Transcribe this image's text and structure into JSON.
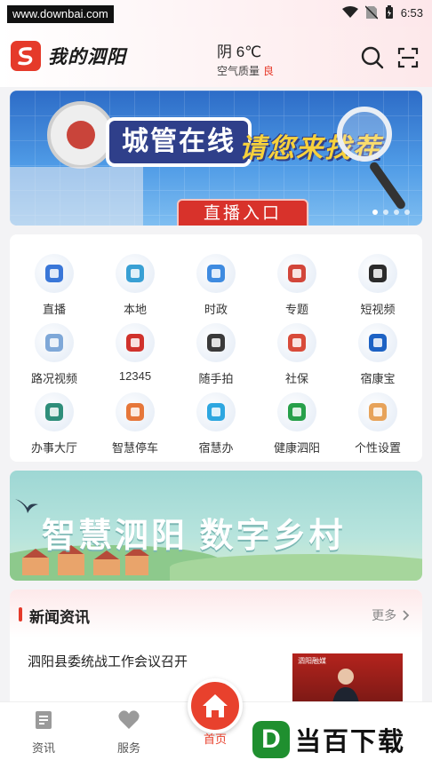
{
  "status_bar": {
    "watermark_url": "www.downbai.com",
    "time": "6:53"
  },
  "header": {
    "app_name": "我的泗阳",
    "weather_temp": "阴 6℃",
    "air_quality_label": "空气质量",
    "air_quality_value": "良"
  },
  "banner": {
    "title": "城管在线",
    "subtitle": "请您来找茬",
    "button_label": "直播入口"
  },
  "grid": [
    {
      "label": "直播",
      "icon": "live-icon",
      "color": "#3a77d8"
    },
    {
      "label": "本地",
      "icon": "local-icon",
      "color": "#39a0d4"
    },
    {
      "label": "时政",
      "icon": "politics-icon",
      "color": "#3f8be0"
    },
    {
      "label": "专题",
      "icon": "topic-icon",
      "color": "#d2463a"
    },
    {
      "label": "短视频",
      "icon": "clapperboard-icon",
      "color": "#2b2b2b"
    },
    {
      "label": "路况视频",
      "icon": "traffic-map-icon",
      "color": "#7fa8d8"
    },
    {
      "label": "12345",
      "icon": "hotline-12345-icon",
      "color": "#d0322c"
    },
    {
      "label": "随手拍",
      "icon": "camera-icon",
      "color": "#3a3a3a"
    },
    {
      "label": "社保",
      "icon": "social-security-card-icon",
      "color": "#d84b3a"
    },
    {
      "label": "宿康宝",
      "icon": "shield-health-icon",
      "color": "#1d62c4"
    },
    {
      "label": "办事大厅",
      "icon": "service-hall-icon",
      "color": "#2f8e7a"
    },
    {
      "label": "智慧停车",
      "icon": "smart-parking-icon",
      "color": "#e6773a"
    },
    {
      "label": "宿慧办",
      "icon": "suhuiban-logo-icon",
      "color": "#2ea7e0"
    },
    {
      "label": "健康泗阳",
      "icon": "health-cross-icon",
      "color": "#27a04a"
    },
    {
      "label": "个性设置",
      "icon": "settings-clover-icon",
      "color": "#e7a35a"
    }
  ],
  "village_banner": {
    "title": "智慧泗阳 数字乡村"
  },
  "news": {
    "section_title": "新闻资讯",
    "more_label": "更多",
    "items": [
      {
        "title": "泗阳县委统战工作会议召开",
        "thumb_caption": "泗阳融媒"
      }
    ]
  },
  "bottom_nav": {
    "tabs": [
      {
        "label": "资讯",
        "icon": "news-doc-icon"
      },
      {
        "label": "服务",
        "icon": "heart-icon"
      },
      {
        "label": "首页",
        "icon": "home-icon"
      }
    ]
  },
  "corner_watermark": {
    "badge": "D",
    "text": "当百下载"
  },
  "colors": {
    "accent": "#e8412d",
    "banner_blue": "#2d6cc7"
  }
}
